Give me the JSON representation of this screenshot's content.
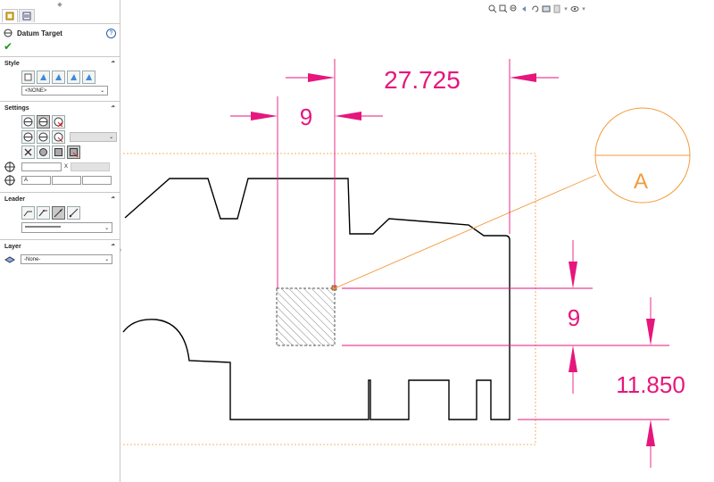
{
  "panel": {
    "title": "Datum Target",
    "help": "?",
    "ok": "✔",
    "style": {
      "heading": "Style",
      "select_value": "<NONE>"
    },
    "settings": {
      "heading": "Settings",
      "x_label": "X",
      "field_a": "A"
    },
    "leader": {
      "heading": "Leader"
    },
    "layer": {
      "heading": "Layer",
      "select_value": "-None-"
    }
  },
  "drawing": {
    "dim_27": "27.725",
    "dim_9_horizontal": "9",
    "dim_9_vertical": "9",
    "dim_11": "11.850",
    "datum_label": "A"
  },
  "colors": {
    "dimension": "#e6167d",
    "datum": "#f39a3c",
    "geometry": "#000000"
  }
}
